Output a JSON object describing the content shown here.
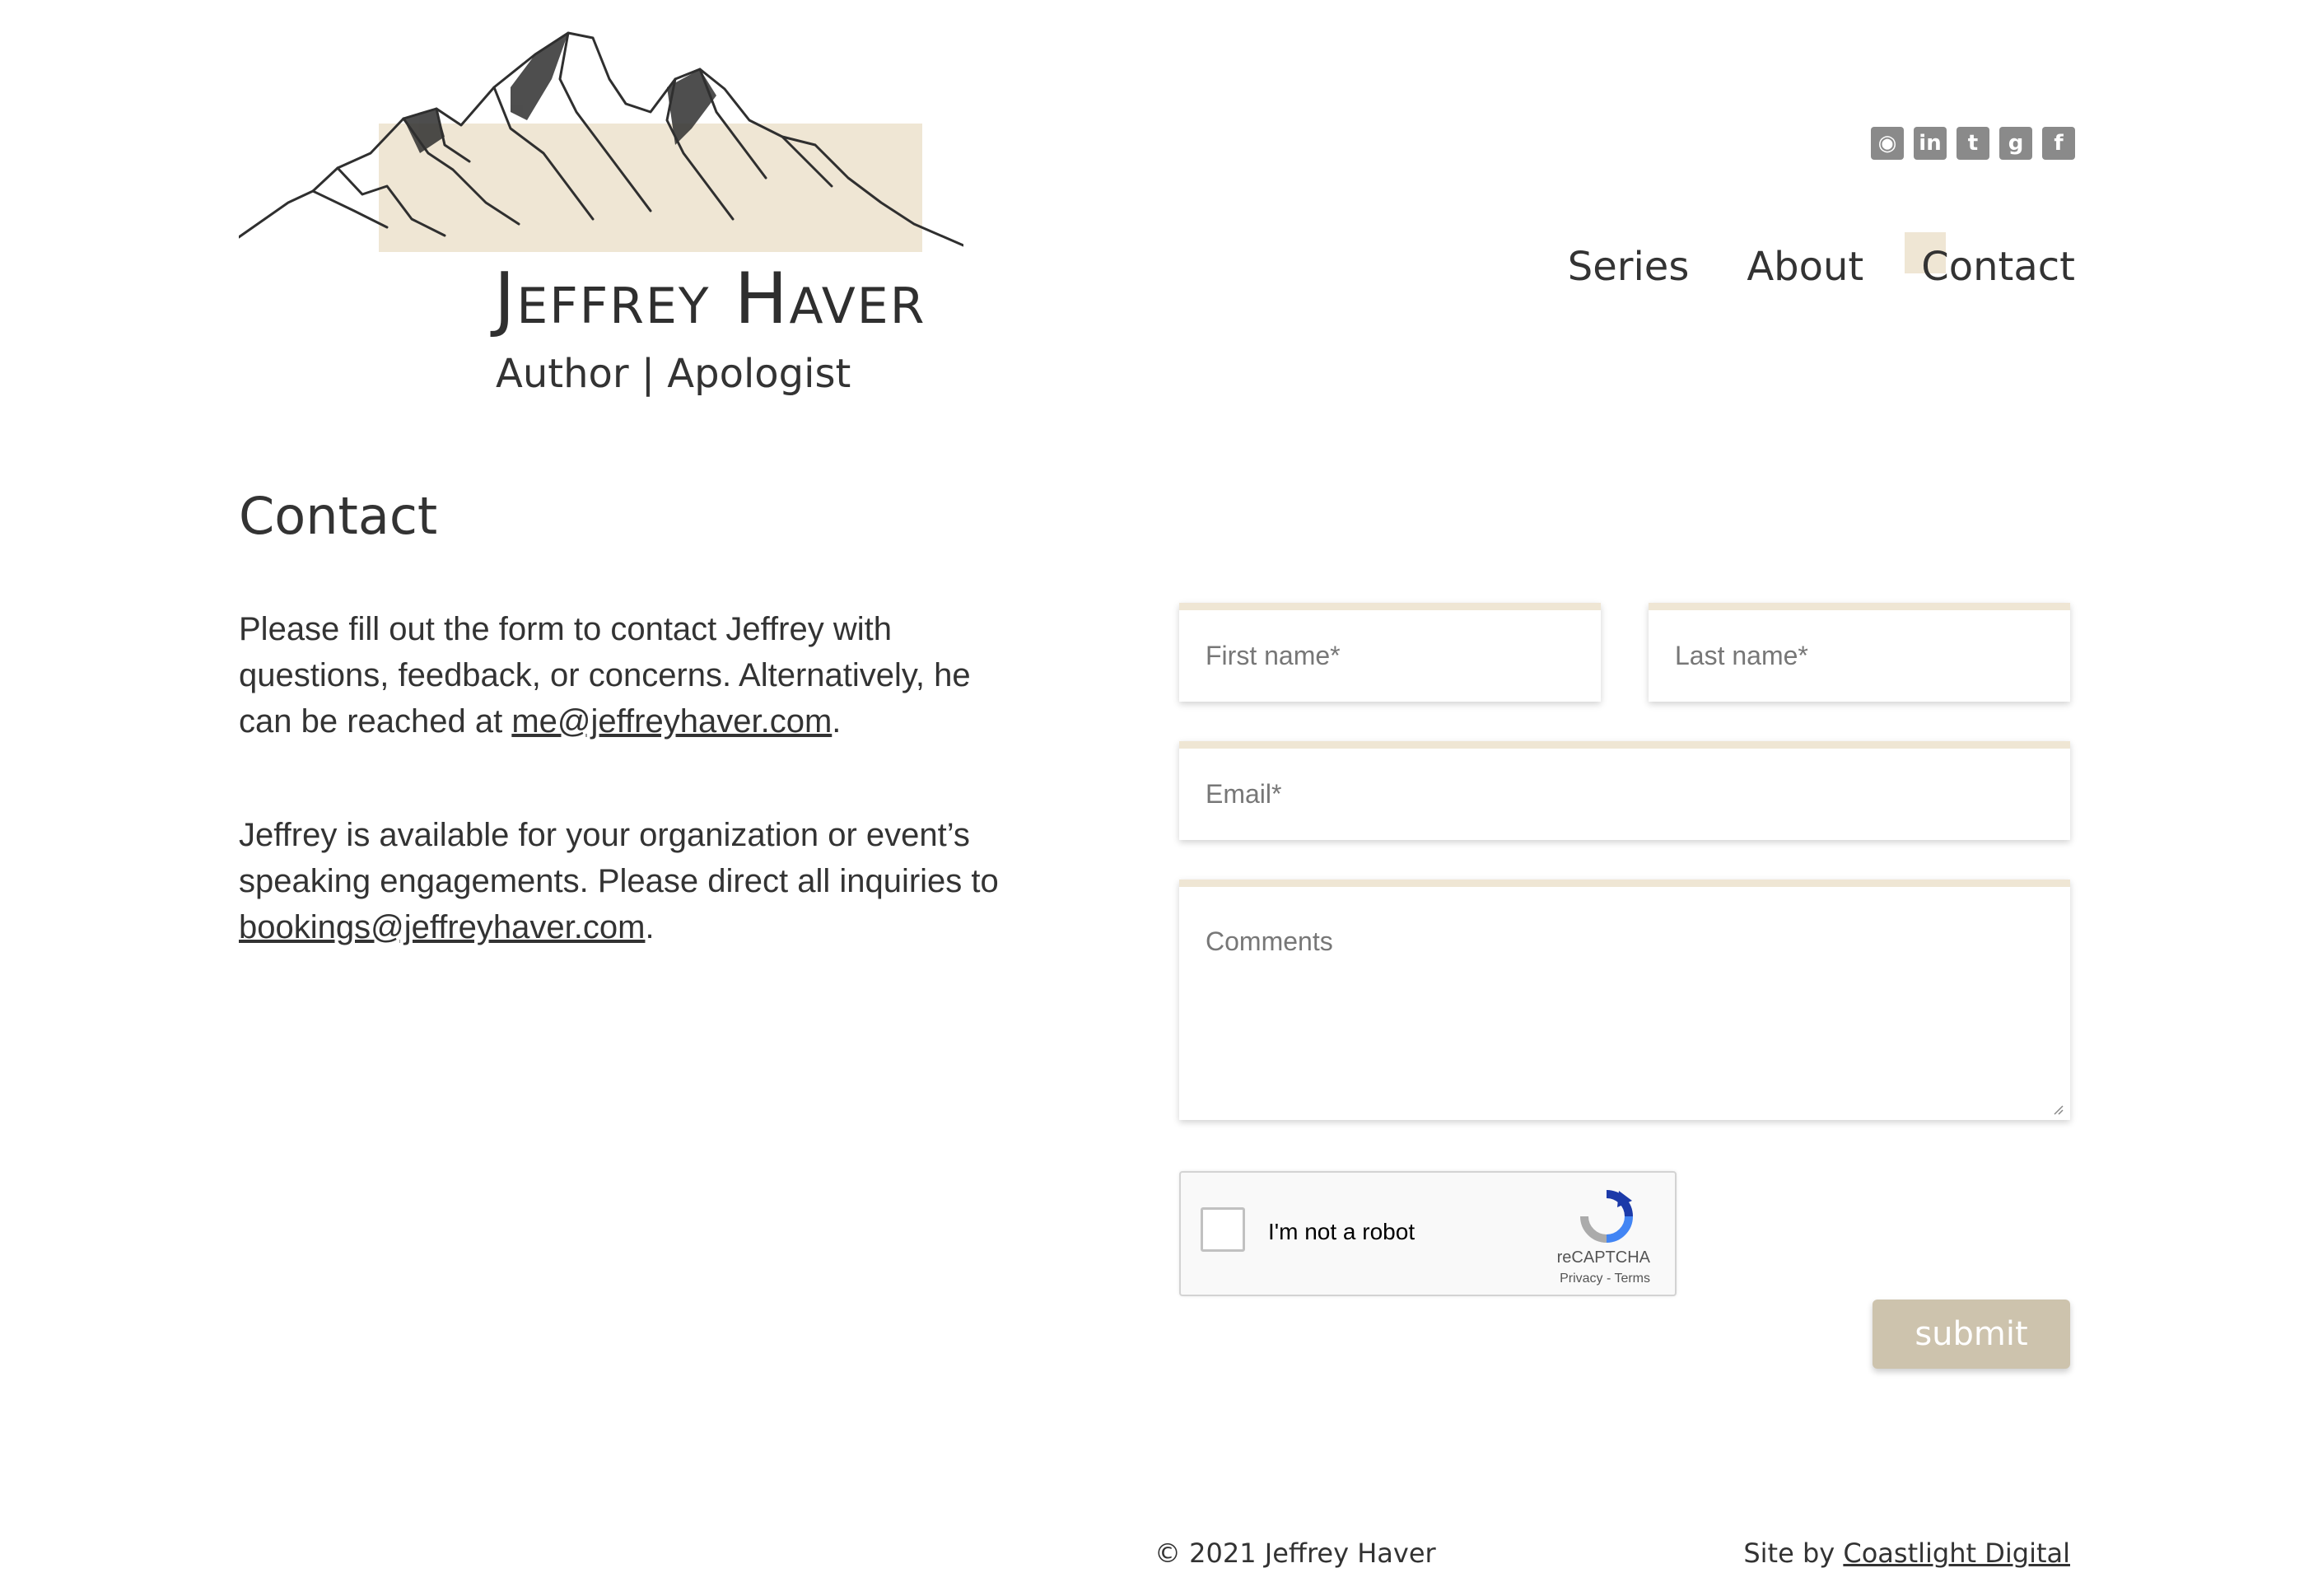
{
  "header": {
    "site_title": "Jeffrey Haver",
    "tagline": "Author | Apologist"
  },
  "social": [
    {
      "icon": "rss-icon",
      "glyph": "◉"
    },
    {
      "icon": "linkedin-icon",
      "glyph": "in"
    },
    {
      "icon": "twitter-icon",
      "glyph": "t"
    },
    {
      "icon": "goodreads-icon",
      "glyph": "g"
    },
    {
      "icon": "facebook-icon",
      "glyph": "f"
    }
  ],
  "nav": {
    "items": [
      {
        "label": "Series"
      },
      {
        "label": "About"
      },
      {
        "label": "Contact",
        "active": true
      }
    ]
  },
  "main": {
    "heading": "Contact",
    "para1_text": "Please fill out the form to contact Jeffrey with questions, feedback, or concerns. Alternatively, he can be reached at ",
    "para1_email": "me@jeffreyhaver.com",
    "para1_end": ".",
    "para2_text": "Jeffrey is available for your organization or event’s speaking engagements. Please direct all inquiries to ",
    "para2_email": "bookings@jeffreyhaver.com",
    "para2_end": "."
  },
  "form": {
    "first_name_placeholder": "First name*",
    "last_name_placeholder": "Last name*",
    "email_placeholder": "Email*",
    "comments_placeholder": "Comments",
    "captcha_label": "I'm not a robot",
    "captcha_brand": "reCAPTCHA",
    "captcha_links": "Privacy - Terms",
    "submit_label": "submit"
  },
  "footer": {
    "copyright": "© 2021 Jeffrey Haver",
    "credit_prefix": "Site by ",
    "credit_link": "Coastlight Digital"
  },
  "colors": {
    "accent_beige": "#efe6d4",
    "button_beige": "#cdc3ad",
    "icon_gray": "#8a8a8a",
    "text": "#333333"
  }
}
